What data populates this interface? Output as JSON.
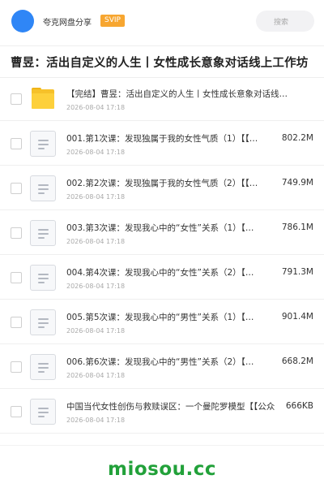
{
  "header": {
    "site_name": "夸克网盘分享",
    "badge": "SVIP",
    "search_placeholder": "搜索"
  },
  "page_title": "曹昱：活出自定义的人生丨女性成长意象对话线上工作坊",
  "files": [
    {
      "type": "folder",
      "name": "【完结】曹昱：活出自定义的人生丨女性成长意象对话线…",
      "date": "2026-08-04 17:18",
      "size": ""
    },
    {
      "type": "file",
      "name": "001.第1次课：发现独属于我的女性气质（1）【【…",
      "date": "2026-08-04 17:18",
      "size": "802.2M"
    },
    {
      "type": "file",
      "name": "002.第2次课：发现独属于我的女性气质（2）【【…",
      "date": "2026-08-04 17:18",
      "size": "749.9M"
    },
    {
      "type": "file",
      "name": "003.第3次课：发现我心中的“女性”关系（1）【…",
      "date": "2026-08-04 17:18",
      "size": "786.1M"
    },
    {
      "type": "file",
      "name": "004.第4次课：发现我心中的“女性”关系（2）【…",
      "date": "2026-08-04 17:18",
      "size": "791.3M"
    },
    {
      "type": "file",
      "name": "005.第5次课：发现我心中的“男性”关系（1）【…",
      "date": "2026-08-04 17:18",
      "size": "901.4M"
    },
    {
      "type": "file",
      "name": "006.第6次课：发现我心中的“男性”关系（2）【…",
      "date": "2026-08-04 17:18",
      "size": "668.2M"
    },
    {
      "type": "file",
      "name": "中国当代女性创伤与救赎误区：一个曼陀罗模型【【公众",
      "date": "2026-08-04 17:18",
      "size": "666KB"
    }
  ],
  "footer": {
    "watermark": "miosou.cc"
  },
  "colors": {
    "accent_blue": "#2f86f6",
    "badge_orange": "#f7a630",
    "folder_yellow": "#fdd03b",
    "watermark_green": "#22a13a"
  }
}
